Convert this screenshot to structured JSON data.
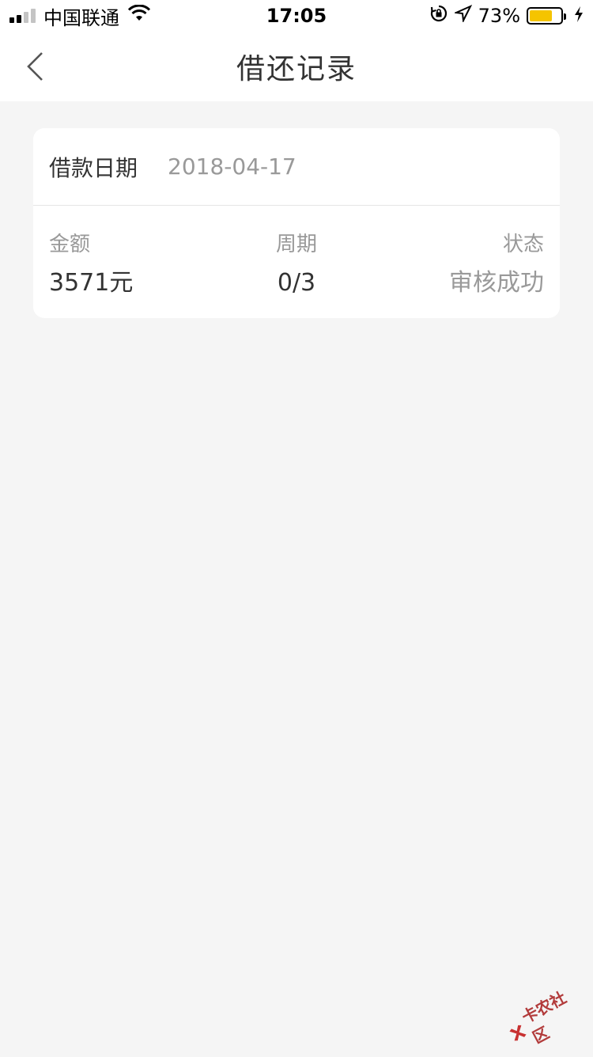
{
  "status_bar": {
    "carrier": "中国联通",
    "time": "17:05",
    "battery_percent": "73%",
    "battery_level": 0.73,
    "battery_color": "#f5c400"
  },
  "nav": {
    "title": "借还记录",
    "back_icon": "chevron-left-icon"
  },
  "record": {
    "date_label": "借款日期",
    "date_value": "2018-04-17",
    "amount_label": "金额",
    "amount_value": "3571元",
    "period_label": "周期",
    "period_value": "0/3",
    "status_label": "状态",
    "status_value": "审核成功"
  },
  "watermark": {
    "text": "卡农社区",
    "color": "#b23b3b"
  }
}
